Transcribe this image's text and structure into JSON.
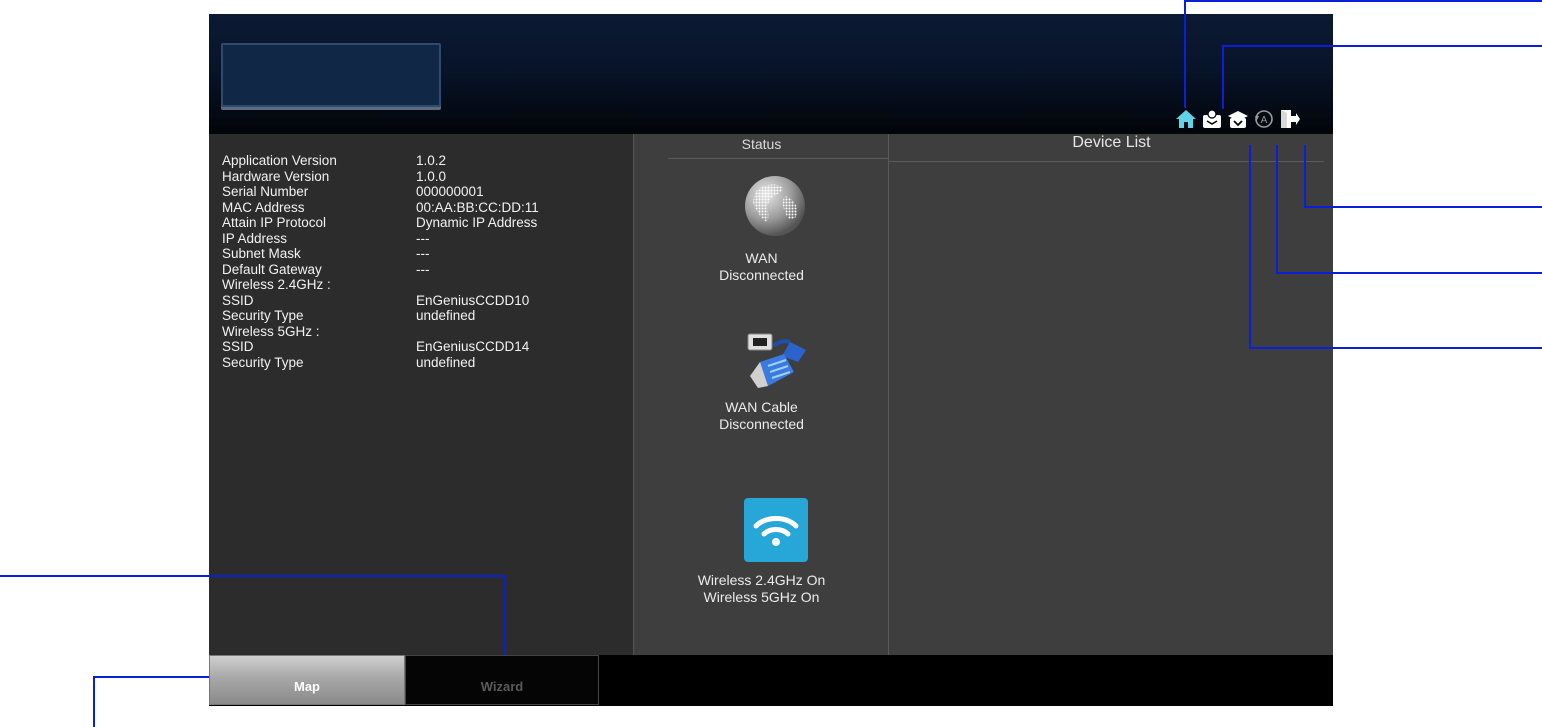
{
  "header": {
    "icons": [
      "home-icon",
      "account-icon",
      "firmware-icon",
      "auto-refresh-icon",
      "logout-icon"
    ]
  },
  "info": {
    "rows": [
      {
        "label": "Application Version",
        "value": "1.0.2"
      },
      {
        "label": "Hardware Version",
        "value": "1.0.0"
      },
      {
        "label": "Serial Number",
        "value": "000000001"
      },
      {
        "label": "MAC Address",
        "value": "00:AA:BB:CC:DD:11"
      },
      {
        "label": "Attain IP Protocol",
        "value": "Dynamic IP Address"
      },
      {
        "label": "IP Address",
        "value": "---"
      },
      {
        "label": "Subnet Mask",
        "value": "---"
      },
      {
        "label": "Default Gateway",
        "value": "---"
      },
      {
        "label": "Wireless 2.4GHz :",
        "value": ""
      },
      {
        "label": "SSID",
        "value": "EnGeniusCCDD10"
      },
      {
        "label": "Security Type",
        "value": "undefined"
      },
      {
        "label": "Wireless 5GHz :",
        "value": ""
      },
      {
        "label": "SSID",
        "value": "EnGeniusCCDD14"
      },
      {
        "label": "Security Type",
        "value": "undefined"
      }
    ]
  },
  "status": {
    "title": "Status",
    "wan": {
      "line1": "WAN",
      "line2": "Disconnected"
    },
    "cable": {
      "line1": "WAN Cable",
      "line2": "Disconnected"
    },
    "wireless": {
      "line1": "Wireless 2.4GHz On",
      "line2": "Wireless 5GHz On"
    }
  },
  "device_list": {
    "title": "Device List"
  },
  "tabs": {
    "map": "Map",
    "wizard": "Wizard"
  },
  "colors": {
    "callout": "#0a1fd6",
    "home_icon": "#5fd3e8",
    "wifi_tile": "#27a6d8"
  }
}
